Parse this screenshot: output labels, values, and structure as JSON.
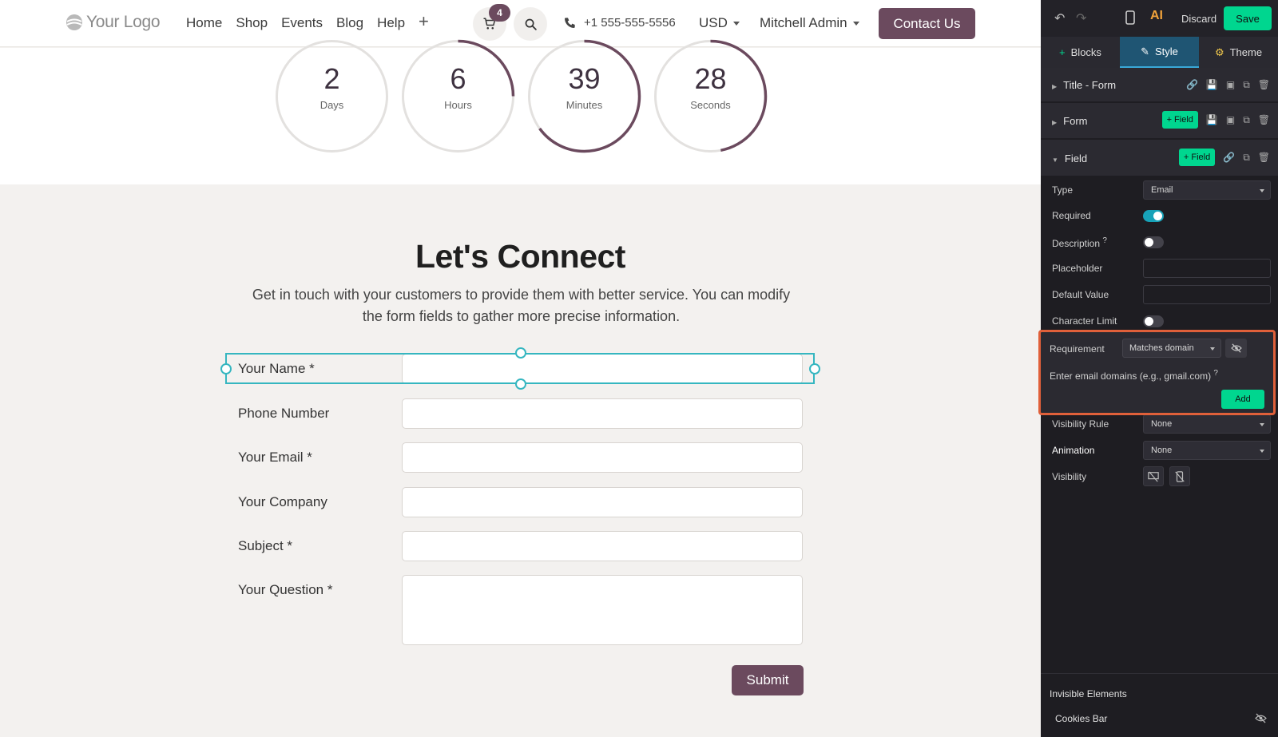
{
  "site": {
    "logo_text": "Your Logo",
    "nav": [
      "Home",
      "Shop",
      "Events",
      "Blog",
      "Help"
    ],
    "plus": "+",
    "cart_count": "4",
    "phone": "+1 555-555-5556",
    "currency": "USD",
    "user": "Mitchell Admin",
    "contact_label": "Contact Us",
    "brand_color": "#6b4a5e"
  },
  "countdown": [
    {
      "value": "2",
      "unit": "Days",
      "progress": 0.0
    },
    {
      "value": "6",
      "unit": "Hours",
      "progress": 0.25
    },
    {
      "value": "39",
      "unit": "Minutes",
      "progress": 0.65
    },
    {
      "value": "28",
      "unit": "Seconds",
      "progress": 0.47
    }
  ],
  "connect": {
    "title": "Let's Connect",
    "lead": "Get in touch with your customers to provide them with better service. You can modify the form fields to gather more precise information.",
    "fields": [
      {
        "label": "Your Name *"
      },
      {
        "label": "Phone Number"
      },
      {
        "label": "Your Email *"
      },
      {
        "label": "Your Company"
      },
      {
        "label": "Subject *"
      },
      {
        "label": "Your Question *"
      }
    ],
    "submit": "Submit"
  },
  "editor": {
    "discard": "Discard",
    "save": "Save",
    "tabs": [
      "Blocks",
      "Style",
      "Theme"
    ],
    "sections": {
      "title_form": "Title - Form",
      "form": "Form",
      "field": "Field",
      "field_btn": "+ Field"
    },
    "options": {
      "type_label": "Type",
      "type_value": "Email",
      "required_label": "Required",
      "description_label": "Description",
      "description_help": "?",
      "placeholder_label": "Placeholder",
      "default_label": "Default Value",
      "charlimit_label": "Character Limit",
      "requirement_label": "Requirement",
      "requirement_value": "Matches domain",
      "domains_label": "Enter email domains (e.g., gmail.com)",
      "domains_help": "?",
      "add_label": "Add",
      "visibility_rule_label": "Visibility Rule",
      "visibility_rule_value": "None",
      "animation_label": "Animation",
      "animation_value": "None",
      "visibility_label": "Visibility"
    },
    "invisible_elements": "Invisible Elements",
    "cookies_bar": "Cookies Bar",
    "accent_green": "#00d68f",
    "highlight_orange": "#e0603a"
  }
}
